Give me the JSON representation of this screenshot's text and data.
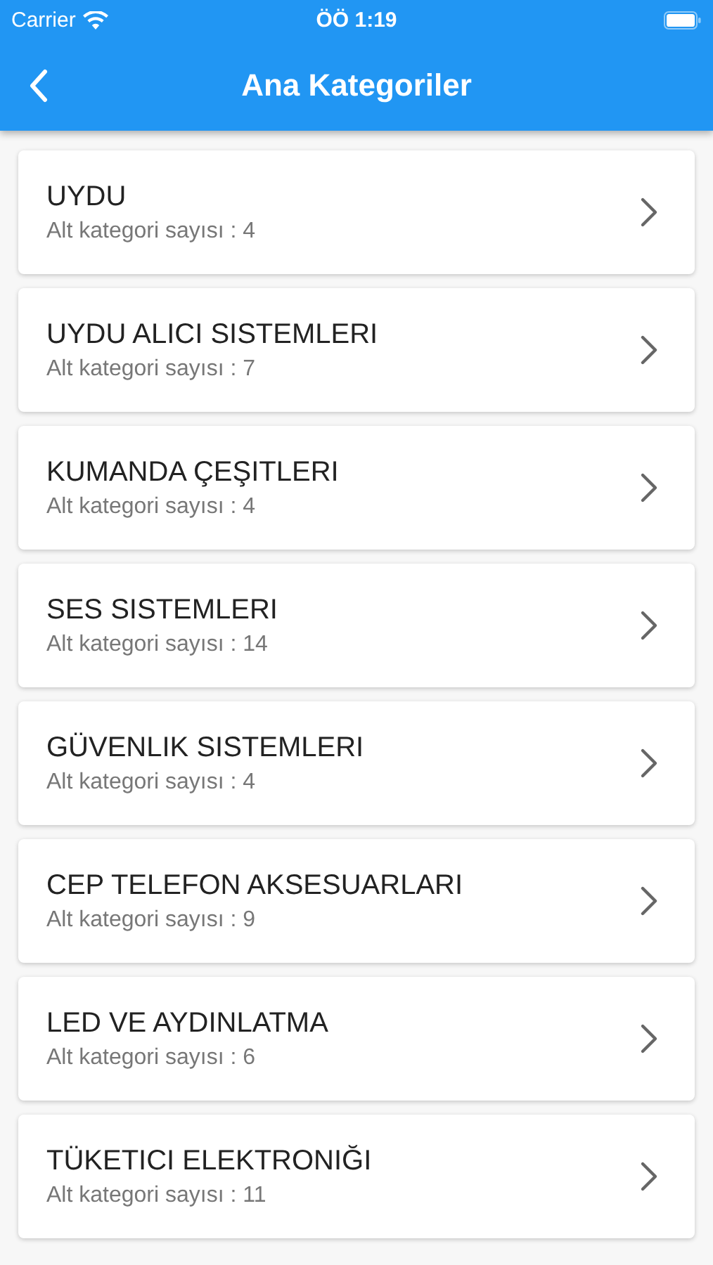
{
  "status_bar": {
    "carrier": "Carrier",
    "time": "ÖÖ 1:19"
  },
  "nav_bar": {
    "title": "Ana Kategoriler"
  },
  "categories": [
    {
      "name": "UYDU",
      "subtitle": "Alt kategori sayısı : 4"
    },
    {
      "name": "UYDU ALICI SISTEMLERI",
      "subtitle": "Alt kategori sayısı : 7"
    },
    {
      "name": "KUMANDA ÇEŞITLERI",
      "subtitle": "Alt kategori sayısı : 4"
    },
    {
      "name": "SES SISTEMLERI",
      "subtitle": "Alt kategori sayısı : 14"
    },
    {
      "name": "GÜVENLIK SISTEMLERI",
      "subtitle": "Alt kategori sayısı : 4"
    },
    {
      "name": "CEP TELEFON AKSESUARLARI",
      "subtitle": "Alt kategori sayısı : 9"
    },
    {
      "name": "LED VE AYDINLATMA",
      "subtitle": "Alt kategori sayısı : 6"
    },
    {
      "name": "TÜKETICI ELEKTRONIĞI",
      "subtitle": "Alt kategori sayısı : 11"
    }
  ]
}
